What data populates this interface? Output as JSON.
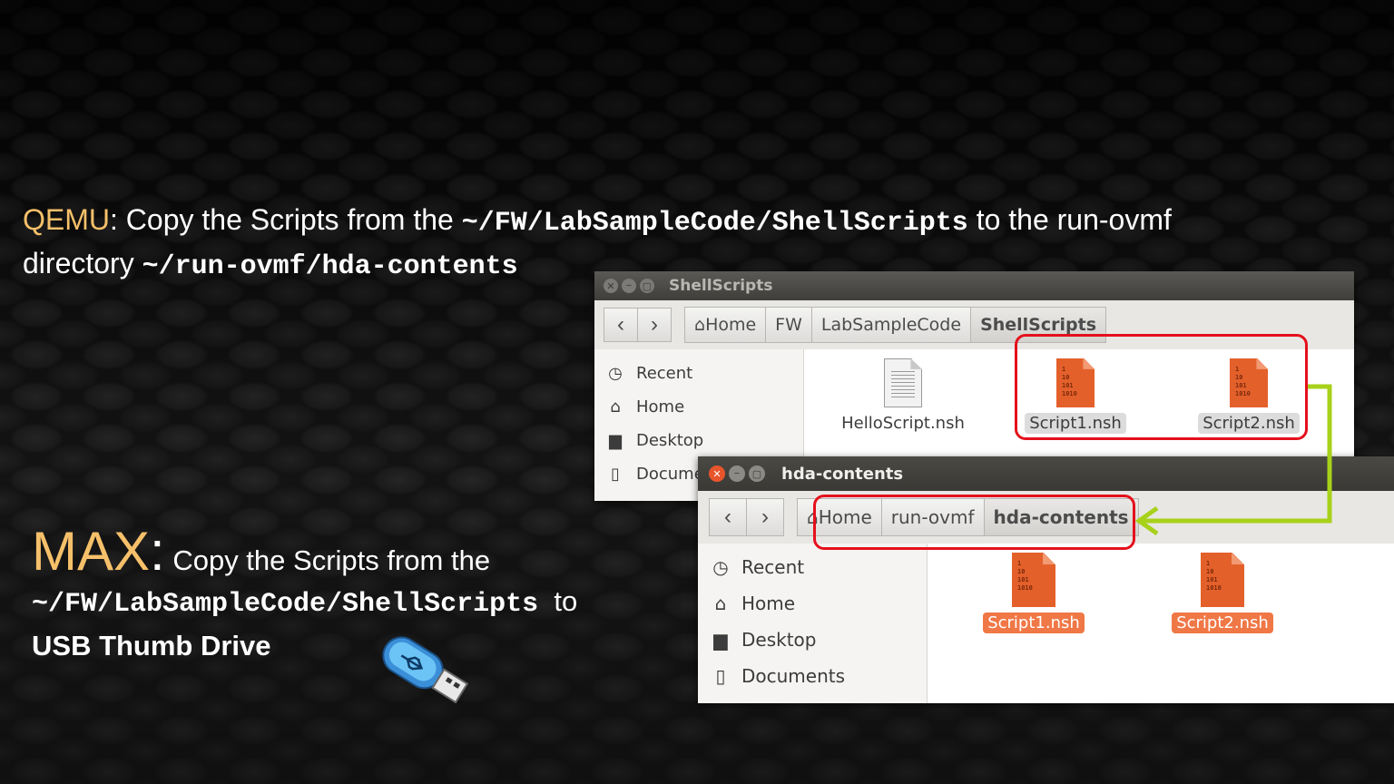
{
  "slide": {
    "qemu_label": "QEMU",
    "qemu_text1": ": Copy the Scripts from the ",
    "qemu_path1": "~/FW/LabSampleCode/ShellScripts",
    "qemu_text2": " to the run-ovmf",
    "qemu_text3": "directory ",
    "qemu_path2": "~/run-ovmf/hda-contents",
    "max_label": "MAX",
    "max_colon": ":",
    "max_text1": "Copy the Scripts from the",
    "max_path": "~/FW/LabSampleCode/ShellScripts",
    "max_to": "to",
    "max_dest": "USB Thumb Drive"
  },
  "window1": {
    "title": "ShellScripts",
    "breadcrumb": [
      "Home",
      "FW",
      "LabSampleCode",
      "ShellScripts"
    ],
    "sidebar": [
      "Recent",
      "Home",
      "Desktop",
      "Docume"
    ],
    "files": [
      "HelloScript.nsh",
      "Script1.nsh",
      "Script2.nsh"
    ]
  },
  "window2": {
    "title": "hda-contents",
    "breadcrumb": [
      "Home",
      "run-ovmf",
      "hda-contents"
    ],
    "sidebar": [
      "Recent",
      "Home",
      "Desktop",
      "Documents"
    ],
    "files": [
      "Script1.nsh",
      "Script2.nsh"
    ]
  },
  "colors": {
    "accent_orange": "#f6c06a",
    "file_orange": "#e4602a",
    "highlight_red": "#e4101c",
    "arrow_green": "#a8d11a"
  },
  "icons": [
    "clock-icon",
    "home-icon",
    "folder-icon",
    "document-icon",
    "usb-drive-icon"
  ]
}
